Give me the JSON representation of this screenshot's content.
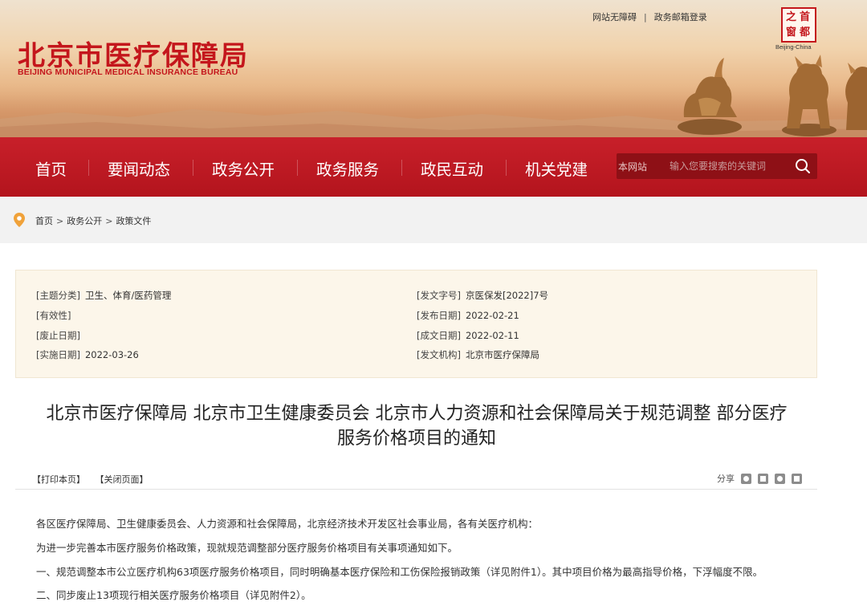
{
  "header": {
    "title": "北京市医疗保障局",
    "subtitle": "BEIJING MUNICIPAL MEDICAL INSURANCE BUREAU",
    "top_links": [
      "网站无障碍",
      "政务邮箱登录"
    ],
    "top_link_separator": "|",
    "logo_glyphs": [
      "首",
      "都",
      "之",
      "窗"
    ],
    "logo_caption": "Beijing-China"
  },
  "nav": {
    "items": [
      "首页",
      "要闻动态",
      "政务公开",
      "政务服务",
      "政民互动",
      "机关党建"
    ],
    "search_scope": "本网站",
    "search_placeholder": "输入您要搜索的关键词"
  },
  "breadcrumb": [
    "首页",
    "政务公开",
    "政策文件"
  ],
  "breadcrumb_separator": ">",
  "meta": {
    "left": [
      {
        "key": "[主题分类]",
        "value": "卫生、体育/医药管理"
      },
      {
        "key": "[有效性]",
        "value": ""
      },
      {
        "key": "[废止日期]",
        "value": ""
      },
      {
        "key": "[实施日期]",
        "value": "2022-03-26"
      }
    ],
    "right": [
      {
        "key": "[发文字号]",
        "value": "京医保发[2022]7号"
      },
      {
        "key": "[发布日期]",
        "value": "2022-02-21"
      },
      {
        "key": "[成文日期]",
        "value": "2022-02-11"
      },
      {
        "key": "[发文机构]",
        "value": "北京市医疗保障局"
      }
    ]
  },
  "article": {
    "title_line1": "北京市医疗保障局 北京市卫生健康委员会 北京市人力资源和社会保障局关于规范调整 部分医疗",
    "title_line2": "服务价格项目的通知",
    "print_label": "【打印本页】",
    "close_label": "【关闭页面】",
    "share_label": "分享",
    "paragraphs": [
      "各区医疗保障局、卫生健康委员会、人力资源和社会保障局，北京经济技术开发区社会事业局，各有关医疗机构：",
      "为进一步完善本市医疗服务价格政策，现就规范调整部分医疗服务价格项目有关事项通知如下。",
      "一、规范调整本市公立医疗机构63项医疗服务价格项目，同时明确基本医疗保险和工伤保险报销政策（详见附件1）。其中项目价格为最高指导价格，下浮幅度不限。",
      "二、同步废止13项现行相关医疗服务价格项目（详见附件2）。"
    ]
  },
  "colors": {
    "brand_red": "#c4161c",
    "nav_red": "#b3141d",
    "meta_bg": "#fcf6ea"
  }
}
